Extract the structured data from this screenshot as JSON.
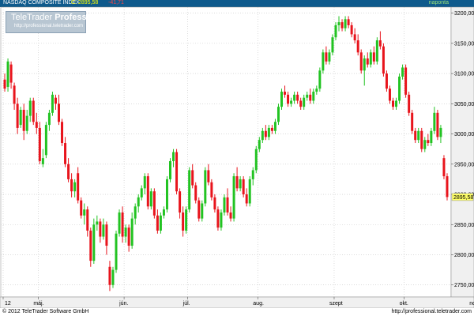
{
  "header": {
    "title": "NASDAQ COMPOSITE INDEX",
    "last": "C: 2895,58",
    "change": "-41,71",
    "interval": "naponta"
  },
  "logo": {
    "name_a": "TeleTrader ",
    "name_b": "Professional",
    "url": "http://professional.teletrader.com"
  },
  "footer": {
    "copyright": "© 2012 TeleTrader Software GmbH",
    "url": "http://professional.teletrader.com"
  },
  "colors": {
    "up": "#22c322",
    "down": "#e8141c",
    "grid": "#c5c5c5",
    "axis_bg": "#f0f0f0",
    "last_tag": "#ffff66"
  },
  "chart_data": {
    "type": "candlestick",
    "title": "NASDAQ COMPOSITE INDEX",
    "xlabel": "",
    "ylabel": "",
    "ylim": [
      2730,
      3210
    ],
    "y_ticks": [
      "3200,00",
      "3150,00",
      "3100,00",
      "3050,00",
      "3000,00",
      "2950,00",
      "2900,00",
      "2850,00",
      "2800,00",
      "2750,00"
    ],
    "y_tick_values": [
      3200,
      3150,
      3100,
      3050,
      3000,
      2950,
      2900,
      2850,
      2800,
      2750
    ],
    "last_value_label": "2895,58",
    "last_value": 2895.58,
    "x_ticks": [
      "12",
      "máj.",
      "jún.",
      "júl.",
      "aug.",
      "szept",
      "okt.",
      "nov."
    ],
    "x_tick_positions": [
      0,
      11,
      38,
      58,
      80,
      104,
      126,
      148
    ],
    "grid": true,
    "series": [
      {
        "ohlc": [
          [
            3090,
            3100,
            3070,
            3075
          ],
          [
            3078,
            3125,
            3070,
            3120
          ],
          [
            3115,
            3120,
            3075,
            3085
          ],
          [
            3080,
            3085,
            3040,
            3050
          ],
          [
            3050,
            3060,
            3000,
            3010
          ],
          [
            3015,
            3045,
            3010,
            3040
          ],
          [
            3040,
            3050,
            2990,
            3005
          ],
          [
            3005,
            3040,
            3000,
            3030
          ],
          [
            3030,
            3060,
            3020,
            3055
          ],
          [
            3055,
            3060,
            3015,
            3020
          ],
          [
            3020,
            3035,
            3000,
            3010
          ],
          [
            3010,
            3020,
            2950,
            2955
          ],
          [
            2950,
            2975,
            2945,
            2960
          ],
          [
            2965,
            3020,
            2960,
            3015
          ],
          [
            3015,
            3040,
            3005,
            3035
          ],
          [
            3035,
            3070,
            3030,
            3065
          ],
          [
            3060,
            3065,
            3040,
            3050
          ],
          [
            3050,
            3065,
            3015,
            3020
          ],
          [
            3020,
            3025,
            2980,
            2985
          ],
          [
            2985,
            2995,
            2945,
            2950
          ],
          [
            2950,
            2960,
            2920,
            2925
          ],
          [
            2925,
            2935,
            2895,
            2905
          ],
          [
            2905,
            2925,
            2895,
            2920
          ],
          [
            2935,
            2945,
            2885,
            2890
          ],
          [
            2890,
            2895,
            2860,
            2865
          ],
          [
            2865,
            2885,
            2850,
            2875
          ],
          [
            2875,
            2880,
            2830,
            2840
          ],
          [
            2840,
            2845,
            2780,
            2790
          ],
          [
            2790,
            2860,
            2785,
            2850
          ],
          [
            2850,
            2865,
            2840,
            2855
          ],
          [
            2855,
            2860,
            2820,
            2830
          ],
          [
            2830,
            2860,
            2825,
            2850
          ],
          [
            2850,
            2855,
            2800,
            2815
          ],
          [
            2780,
            2790,
            2740,
            2750
          ],
          [
            2750,
            2780,
            2745,
            2775
          ],
          [
            2775,
            2840,
            2770,
            2835
          ],
          [
            2835,
            2875,
            2830,
            2870
          ],
          [
            2870,
            2880,
            2820,
            2830
          ],
          [
            2830,
            2850,
            2820,
            2845
          ],
          [
            2845,
            2850,
            2805,
            2815
          ],
          [
            2815,
            2870,
            2810,
            2860
          ],
          [
            2860,
            2885,
            2850,
            2880
          ],
          [
            2880,
            2900,
            2870,
            2895
          ],
          [
            2895,
            2915,
            2890,
            2910
          ],
          [
            2910,
            2935,
            2900,
            2930
          ],
          [
            2930,
            2935,
            2875,
            2880
          ],
          [
            2880,
            2910,
            2875,
            2905
          ],
          [
            2905,
            2910,
            2860,
            2865
          ],
          [
            2865,
            2875,
            2835,
            2840
          ],
          [
            2840,
            2870,
            2835,
            2865
          ],
          [
            2865,
            2880,
            2860,
            2875
          ],
          [
            2875,
            2930,
            2870,
            2925
          ],
          [
            2925,
            2960,
            2920,
            2955
          ],
          [
            2955,
            2975,
            2945,
            2970
          ],
          [
            2970,
            2975,
            2900,
            2905
          ],
          [
            2905,
            2910,
            2860,
            2870
          ],
          [
            2870,
            2880,
            2830,
            2840
          ],
          [
            2840,
            2880,
            2835,
            2875
          ],
          [
            2875,
            2945,
            2870,
            2940
          ],
          [
            2940,
            2950,
            2910,
            2915
          ],
          [
            2915,
            2920,
            2885,
            2890
          ],
          [
            2890,
            2895,
            2855,
            2860
          ],
          [
            2860,
            2890,
            2855,
            2885
          ],
          [
            2885,
            2945,
            2880,
            2940
          ],
          [
            2940,
            2950,
            2915,
            2920
          ],
          [
            2920,
            2925,
            2890,
            2895
          ],
          [
            2895,
            2900,
            2870,
            2875
          ],
          [
            2875,
            2880,
            2840,
            2845
          ],
          [
            2845,
            2875,
            2840,
            2870
          ],
          [
            2870,
            2900,
            2865,
            2895
          ],
          [
            2895,
            2910,
            2865,
            2870
          ],
          [
            2870,
            2880,
            2855,
            2860
          ],
          [
            2860,
            2935,
            2855,
            2930
          ],
          [
            2930,
            2945,
            2905,
            2910
          ],
          [
            2910,
            2930,
            2905,
            2925
          ],
          [
            2925,
            2930,
            2895,
            2900
          ],
          [
            2900,
            2910,
            2880,
            2885
          ],
          [
            2885,
            2930,
            2880,
            2925
          ],
          [
            2925,
            2945,
            2915,
            2940
          ],
          [
            2940,
            2980,
            2935,
            2975
          ],
          [
            2975,
            2995,
            2970,
            2990
          ],
          [
            2990,
            3010,
            2985,
            3005
          ],
          [
            3005,
            3015,
            2990,
            2995
          ],
          [
            2995,
            3015,
            2990,
            3010
          ],
          [
            3010,
            3015,
            3000,
            3005
          ],
          [
            3005,
            3025,
            3000,
            3020
          ],
          [
            3020,
            3050,
            3015,
            3045
          ],
          [
            3045,
            3075,
            3040,
            3070
          ],
          [
            3070,
            3080,
            3060,
            3065
          ],
          [
            3065,
            3070,
            3045,
            3050
          ],
          [
            3050,
            3060,
            3045,
            3055
          ],
          [
            3055,
            3070,
            3050,
            3065
          ],
          [
            3065,
            3070,
            3050,
            3055
          ],
          [
            3055,
            3060,
            3040,
            3045
          ],
          [
            3045,
            3065,
            3040,
            3060
          ],
          [
            3060,
            3070,
            3055,
            3065
          ],
          [
            3065,
            3075,
            3050,
            3055
          ],
          [
            3055,
            3075,
            3050,
            3070
          ],
          [
            3070,
            3080,
            3065,
            3075
          ],
          [
            3075,
            3110,
            3070,
            3105
          ],
          [
            3105,
            3140,
            3100,
            3135
          ],
          [
            3135,
            3145,
            3115,
            3120
          ],
          [
            3120,
            3140,
            3115,
            3135
          ],
          [
            3135,
            3165,
            3130,
            3160
          ],
          [
            3160,
            3185,
            3155,
            3180
          ],
          [
            3180,
            3195,
            3170,
            3185
          ],
          [
            3185,
            3190,
            3170,
            3175
          ],
          [
            3175,
            3195,
            3170,
            3190
          ],
          [
            3190,
            3195,
            3175,
            3180
          ],
          [
            3180,
            3185,
            3160,
            3165
          ],
          [
            3165,
            3175,
            3150,
            3155
          ],
          [
            3155,
            3165,
            3130,
            3135
          ],
          [
            3135,
            3140,
            3100,
            3105
          ],
          [
            3105,
            3130,
            3080,
            3125
          ],
          [
            3125,
            3135,
            3110,
            3115
          ],
          [
            3115,
            3140,
            3110,
            3135
          ],
          [
            3135,
            3145,
            3115,
            3120
          ],
          [
            3120,
            3160,
            3115,
            3155
          ],
          [
            3155,
            3170,
            3140,
            3145
          ],
          [
            3145,
            3150,
            3095,
            3100
          ],
          [
            3100,
            3105,
            3070,
            3075
          ],
          [
            3075,
            3080,
            3050,
            3055
          ],
          [
            3055,
            3060,
            3040,
            3045
          ],
          [
            3045,
            3060,
            3040,
            3055
          ],
          [
            3055,
            3100,
            3050,
            3095
          ],
          [
            3095,
            3115,
            3090,
            3110
          ],
          [
            3110,
            3115,
            3060,
            3065
          ],
          [
            3065,
            3070,
            3030,
            3035
          ],
          [
            3035,
            3040,
            3000,
            3005
          ],
          [
            3005,
            3010,
            2985,
            2990
          ],
          [
            2990,
            3010,
            2985,
            3005
          ],
          [
            3005,
            3010,
            2970,
            2975
          ],
          [
            2975,
            2995,
            2970,
            2990
          ],
          [
            2990,
            3000,
            2980,
            2985
          ],
          [
            2985,
            3010,
            2980,
            3005
          ],
          [
            3005,
            3045,
            3000,
            3035
          ],
          [
            3035,
            3040,
            2990,
            2995
          ],
          [
            2995,
            3015,
            2985,
            3010
          ],
          [
            2960,
            2965,
            2925,
            2930
          ],
          [
            2930,
            2935,
            2890,
            2895.58
          ]
        ]
      }
    ]
  }
}
